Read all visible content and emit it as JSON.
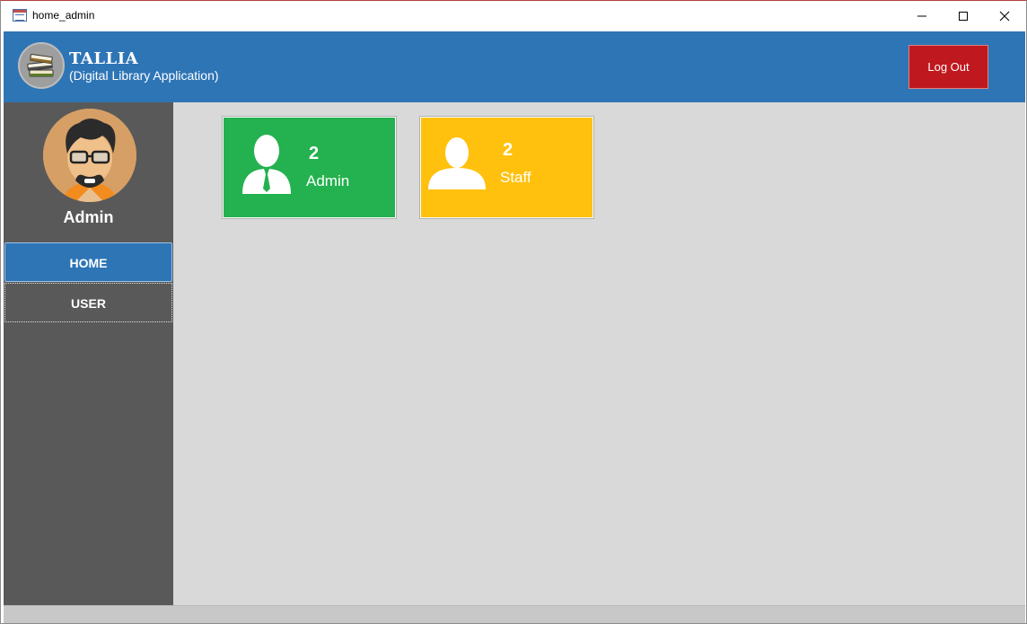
{
  "window": {
    "title": "home_admin",
    "controls": [
      "minimize-icon",
      "maximize-icon",
      "close-icon"
    ]
  },
  "header": {
    "brand": "TALLIA",
    "subtitle": "(Digital Library Application)",
    "logout_label": "Log Out",
    "logo_icon": "books-icon"
  },
  "sidebar": {
    "user_name": "Admin",
    "avatar_icon": "user-avatar",
    "items": [
      {
        "label": "HOME",
        "active": true
      },
      {
        "label": "USER",
        "active": false
      }
    ]
  },
  "dashboard": {
    "cards": [
      {
        "count": "2",
        "label": "Admin",
        "color": "#24b14f",
        "icon": "admin-user-icon"
      },
      {
        "count": "2",
        "label": "Staff",
        "color": "#ffc10e",
        "icon": "staff-user-icon"
      }
    ]
  },
  "colors": {
    "header": "#2e75b6",
    "sidebar": "#595959",
    "main_bg": "#d9d9d9",
    "logout": "#c0181f"
  }
}
